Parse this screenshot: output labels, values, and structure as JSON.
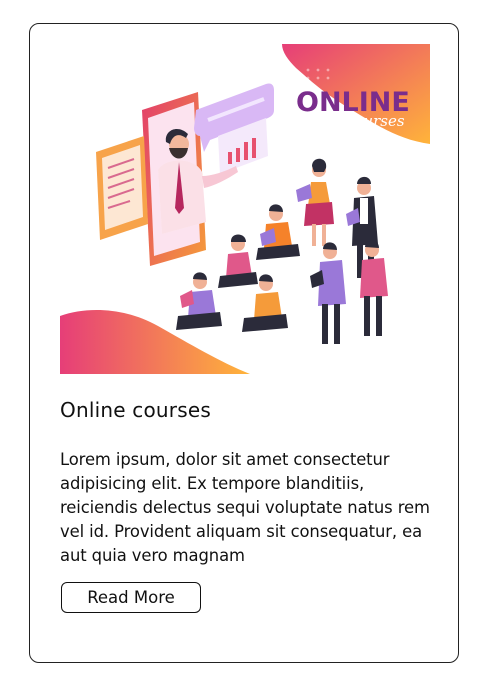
{
  "card": {
    "image": {
      "logo_main": "ONLINE",
      "logo_sub": "courses"
    },
    "title": "Online courses",
    "body": "Lorem ipsum, dolor sit amet consectetur adipisicing elit. Ex tempore blanditiis, reiciendis delectus sequi voluptate natus rem vel id. Provident aliquam sit consequatur, ea aut quia vero magnam",
    "button_label": "Read More"
  },
  "colors": {
    "gradient_pink": "#e63e78",
    "gradient_orange": "#ffb43a",
    "brand_purple": "#7a2d8c",
    "border": "#222222"
  }
}
